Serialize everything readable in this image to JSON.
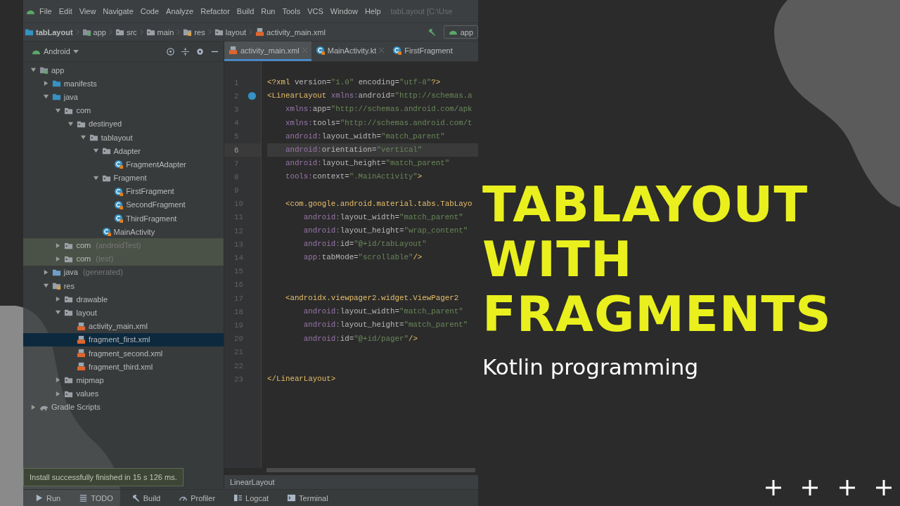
{
  "ide": {
    "menu": [
      "File",
      "Edit",
      "View",
      "Navigate",
      "Code",
      "Analyze",
      "Refactor",
      "Build",
      "Run",
      "Tools",
      "VCS",
      "Window",
      "Help"
    ],
    "window_title": "tabLayout [C:\\Use",
    "breadcrumbs": [
      {
        "label": "tabLayout",
        "kind": "project"
      },
      {
        "label": "app",
        "kind": "module"
      },
      {
        "label": "src",
        "kind": "folder"
      },
      {
        "label": "main",
        "kind": "folder"
      },
      {
        "label": "res",
        "kind": "res"
      },
      {
        "label": "layout",
        "kind": "folder"
      },
      {
        "label": "activity_main.xml",
        "kind": "layout"
      }
    ],
    "run_config": "app",
    "project_view": "Android",
    "tree": [
      {
        "label": "app",
        "kind": "module",
        "expanded": true,
        "selected": false,
        "children": [
          {
            "label": "manifests",
            "kind": "source",
            "expanded": false,
            "selected": false
          },
          {
            "label": "java",
            "kind": "source",
            "expanded": true,
            "selected": false,
            "children": [
              {
                "label": "com",
                "kind": "package",
                "expanded": true,
                "selected": false,
                "children": [
                  {
                    "label": "destinyed",
                    "kind": "package",
                    "expanded": true,
                    "selected": false,
                    "children": [
                      {
                        "label": "tablayout",
                        "kind": "package",
                        "expanded": true,
                        "selected": false,
                        "children": [
                          {
                            "label": "Adapter",
                            "kind": "package",
                            "expanded": true,
                            "selected": false,
                            "children": [
                              {
                                "label": "FragmentAdapter",
                                "kind": "kotlin",
                                "selected": false
                              }
                            ]
                          },
                          {
                            "label": "Fragment",
                            "kind": "package",
                            "expanded": true,
                            "selected": false,
                            "children": [
                              {
                                "label": "FirstFragment",
                                "kind": "kotlin",
                                "selected": false
                              },
                              {
                                "label": "SecondFragment",
                                "kind": "kotlin",
                                "selected": false
                              },
                              {
                                "label": "ThirdFragment",
                                "kind": "kotlin",
                                "selected": false
                              }
                            ]
                          },
                          {
                            "label": "MainActivity",
                            "kind": "kotlin",
                            "selected": false
                          }
                        ]
                      }
                    ]
                  }
                ]
              },
              {
                "label": "com",
                "note": "(androidTest)",
                "kind": "test-package",
                "expanded": false,
                "selected": false
              },
              {
                "label": "com",
                "note": "(test)",
                "kind": "test-package",
                "expanded": false,
                "selected": false
              }
            ]
          },
          {
            "label": "java",
            "note": "(generated)",
            "kind": "generated",
            "expanded": false,
            "selected": false
          },
          {
            "label": "res",
            "kind": "res",
            "expanded": true,
            "selected": false,
            "children": [
              {
                "label": "drawable",
                "kind": "package",
                "expanded": false,
                "selected": false
              },
              {
                "label": "layout",
                "kind": "package",
                "expanded": true,
                "selected": false,
                "children": [
                  {
                    "label": "activity_main.xml",
                    "kind": "layout",
                    "selected": false
                  },
                  {
                    "label": "fragment_first.xml",
                    "kind": "layout",
                    "selected": true
                  },
                  {
                    "label": "fragment_second.xml",
                    "kind": "layout",
                    "selected": false
                  },
                  {
                    "label": "fragment_third.xml",
                    "kind": "layout",
                    "selected": false
                  }
                ]
              },
              {
                "label": "mipmap",
                "kind": "package",
                "expanded": false,
                "selected": false
              },
              {
                "label": "values",
                "kind": "package",
                "expanded": false,
                "selected": false
              }
            ]
          }
        ]
      },
      {
        "label": "Gradle Scripts",
        "kind": "gradle",
        "expanded": false,
        "selected": false
      }
    ],
    "editor_tabs": [
      {
        "label": "activity_main.xml",
        "kind": "layout",
        "selected": true
      },
      {
        "label": "MainActivity.kt",
        "kind": "kotlin",
        "selected": false
      },
      {
        "label": "FirstFragment",
        "kind": "kotlin",
        "selected": false
      }
    ],
    "code": [
      {
        "number": "1",
        "text": "<?xml version=\"1.0\" encoding=\"utf-8\"?>",
        "current": false,
        "marker": false
      },
      {
        "number": "2",
        "text": "<LinearLayout xmlns:android=\"http://schemas.a",
        "current": false,
        "marker": true
      },
      {
        "number": "3",
        "text": "    xmlns:app=\"http://schemas.android.com/apk",
        "current": false,
        "marker": false
      },
      {
        "number": "4",
        "text": "    xmlns:tools=\"http://schemas.android.com/t",
        "current": false,
        "marker": false
      },
      {
        "number": "5",
        "text": "    android:layout_width=\"match_parent\"",
        "current": false,
        "marker": false
      },
      {
        "number": "6",
        "text": "    android:orientation=\"vertical\"",
        "current": true,
        "marker": false
      },
      {
        "number": "7",
        "text": "    android:layout_height=\"match_parent\"",
        "current": false,
        "marker": false
      },
      {
        "number": "8",
        "text": "    tools:context=\".MainActivity\">",
        "current": false,
        "marker": false
      },
      {
        "number": "9",
        "current": false,
        "marker": false
      },
      {
        "number": "10",
        "text": "    <com.google.android.material.tabs.TabLayo",
        "current": false,
        "marker": false
      },
      {
        "number": "11",
        "text": "        android:layout_width=\"match_parent\"",
        "current": false,
        "marker": false
      },
      {
        "number": "12",
        "text": "        android:layout_height=\"wrap_content\"",
        "current": false,
        "marker": false
      },
      {
        "number": "13",
        "text": "        android:id=\"@+id/tabLayout\"",
        "current": false,
        "marker": false
      },
      {
        "number": "14",
        "text": "        app:tabMode=\"scrollable\"/>",
        "current": false,
        "marker": false
      },
      {
        "number": "15",
        "current": false,
        "marker": false
      },
      {
        "number": "16",
        "current": false,
        "marker": false
      },
      {
        "number": "17",
        "text": "    <androidx.viewpager2.widget.ViewPager2",
        "current": false,
        "marker": false
      },
      {
        "number": "18",
        "text": "        android:layout_width=\"match_parent\"",
        "current": false,
        "marker": false
      },
      {
        "number": "19",
        "text": "        android:layout_height=\"match_parent\"",
        "current": false,
        "marker": false
      },
      {
        "number": "20",
        "text": "        android:id=\"@+id/pager\"/>",
        "current": false,
        "marker": false
      },
      {
        "number": "21",
        "current": false,
        "marker": false
      },
      {
        "number": "22",
        "current": false,
        "marker": false
      },
      {
        "number": "23",
        "text": "</LinearLayout>",
        "current": false,
        "marker": false
      }
    ],
    "editor_breadcrumb": "LinearLayout",
    "notification": "Install successfully finished in 15 s 126 ms.",
    "tool_windows": [
      {
        "label": "Run",
        "kind": "run"
      },
      {
        "label": "TODO",
        "kind": "todo"
      },
      {
        "label": "Build",
        "kind": "build"
      },
      {
        "label": "Profiler",
        "kind": "profiler"
      },
      {
        "label": "Logcat",
        "kind": "logcat"
      },
      {
        "label": "Terminal",
        "kind": "terminal"
      }
    ]
  },
  "title_lines": [
    "TABLAYOUT",
    "WITH",
    "FRAGMENTS"
  ],
  "subtitle": "Kotlin programming"
}
